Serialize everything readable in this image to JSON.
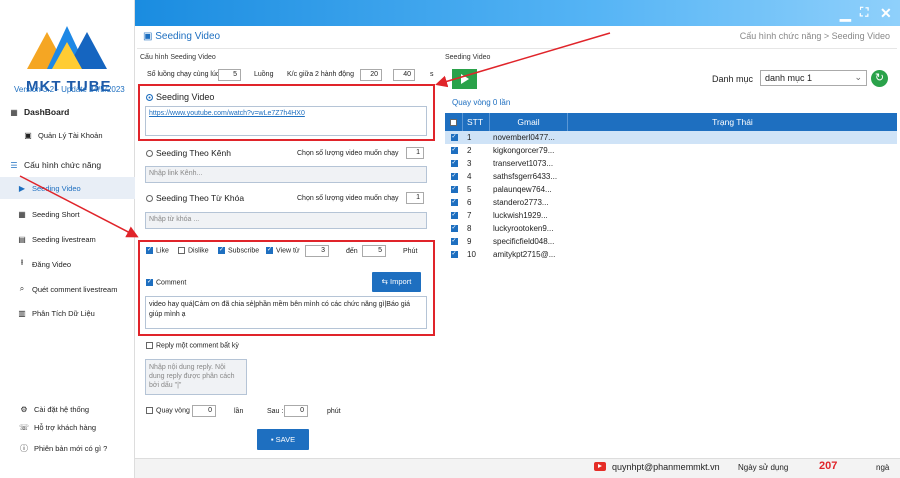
{
  "window": {
    "minimize": "▁",
    "restore": "⛶",
    "close": "✕"
  },
  "sidebar": {
    "brand": "MKT TUBE",
    "version": "Version 3.2 - Update 24/5/2023",
    "items": [
      {
        "label": "DashBoard",
        "icon": "dashboard-icon"
      },
      {
        "label": "Quản Lý Tài Khoản",
        "icon": "account-icon"
      },
      {
        "label": "Cấu hình chức năng",
        "icon": "config-icon"
      },
      {
        "label": "Seeding Video",
        "icon": "play-icon"
      },
      {
        "label": "Seeding Short",
        "icon": "short-icon"
      },
      {
        "label": "Seeding livestream",
        "icon": "live-icon"
      },
      {
        "label": "Đăng Video",
        "icon": "upload-icon"
      },
      {
        "label": "Quét comment livestream",
        "icon": "scan-icon"
      },
      {
        "label": "Phân Tích Dữ Liệu",
        "icon": "chart-icon"
      }
    ],
    "bottom": [
      {
        "label": "Cài đặt hệ thống",
        "icon": "gear-icon"
      },
      {
        "label": "Hỗ trợ khách hàng",
        "icon": "phone-icon"
      },
      {
        "label": "Phiên bản mới có gì ?",
        "icon": "info-icon"
      }
    ]
  },
  "header": {
    "title": "Seeding Video",
    "breadcrumb": "Cấu hình chức năng  >  Seeding Video"
  },
  "config": {
    "section": "Cấu hình Seeding Video",
    "streams_label": "Số luồng chạy cùng lúc",
    "streams_value": "5",
    "streams_unit": "Luồng",
    "delay_label": "K/c giữa 2 hành động",
    "delay_from": "20",
    "delay_to": "40",
    "delay_unit": "s",
    "opt_video": "Seeding Video",
    "video_link": "https://www.youtube.com/watch?v=wLe7Z7h4HX0",
    "opt_channel": "Seeding Theo Kênh",
    "channel_count_label": "Chọn số lượng video muốn chạy",
    "channel_count": "1",
    "channel_placeholder": "Nhập link Kênh...",
    "opt_keyword": "Seeding Theo Từ Khóa",
    "keyword_count_label": "Chọn số lượng video muốn chạy",
    "keyword_count": "1",
    "keyword_placeholder": "Nhập từ khóa ...",
    "like": "Like",
    "dislike": "Dislike",
    "subscribe": "Subscribe",
    "view_from": "View từ",
    "view_min": "3",
    "view_to_label": "đến",
    "view_max": "5",
    "view_unit": "Phút",
    "comment": "Comment",
    "import": "Import",
    "comment_text": "video hay quá|Cảm ơn đã chia sẻ|phần mềm bên mình có các chức năng gì|Báo giá giúp mình ạ",
    "reply_label": "Reply một comment bất kỳ",
    "reply_placeholder": "Nhập nội dung reply. Nội dung reply được phân cách bởi dấu \"|\"",
    "loop_label": "Quay vòng :",
    "loop_value": "0",
    "loop_unit": "lần",
    "after_label": "Sau :",
    "after_value": "0",
    "after_unit": "phút",
    "save": "SAVE"
  },
  "right": {
    "title": "Seeding Video",
    "loop_status": "Quay vòng 0 lần",
    "category_label": "Danh mục",
    "category_value": "danh mục 1",
    "columns": [
      "STT",
      "Gmail",
      "Trạng Thái"
    ],
    "rows": [
      {
        "stt": "1",
        "gmail": "novemberl0477...",
        "status": ""
      },
      {
        "stt": "2",
        "gmail": "kigkongorcer79...",
        "status": ""
      },
      {
        "stt": "3",
        "gmail": "transervet1073...",
        "status": ""
      },
      {
        "stt": "4",
        "gmail": "sathsfsgerr6433...",
        "status": ""
      },
      {
        "stt": "5",
        "gmail": "palaunqew764...",
        "status": ""
      },
      {
        "stt": "6",
        "gmail": "standero2773...",
        "status": ""
      },
      {
        "stt": "7",
        "gmail": "luckwish1929...",
        "status": ""
      },
      {
        "stt": "8",
        "gmail": "luckyrootoken9...",
        "status": ""
      },
      {
        "stt": "9",
        "gmail": "specificfield048...",
        "status": ""
      },
      {
        "stt": "10",
        "gmail": "amitykpt2715@...",
        "status": ""
      }
    ]
  },
  "status": {
    "user": "quynhpt@phanmemmkt.vn",
    "usage_label": "Ngày sử dụng",
    "days": "207",
    "days_unit": "ngà"
  },
  "colors": {
    "accent": "#1e6fc0",
    "highlight": "#e0242a",
    "play": "#2aa24a",
    "days": "#e0242a"
  }
}
